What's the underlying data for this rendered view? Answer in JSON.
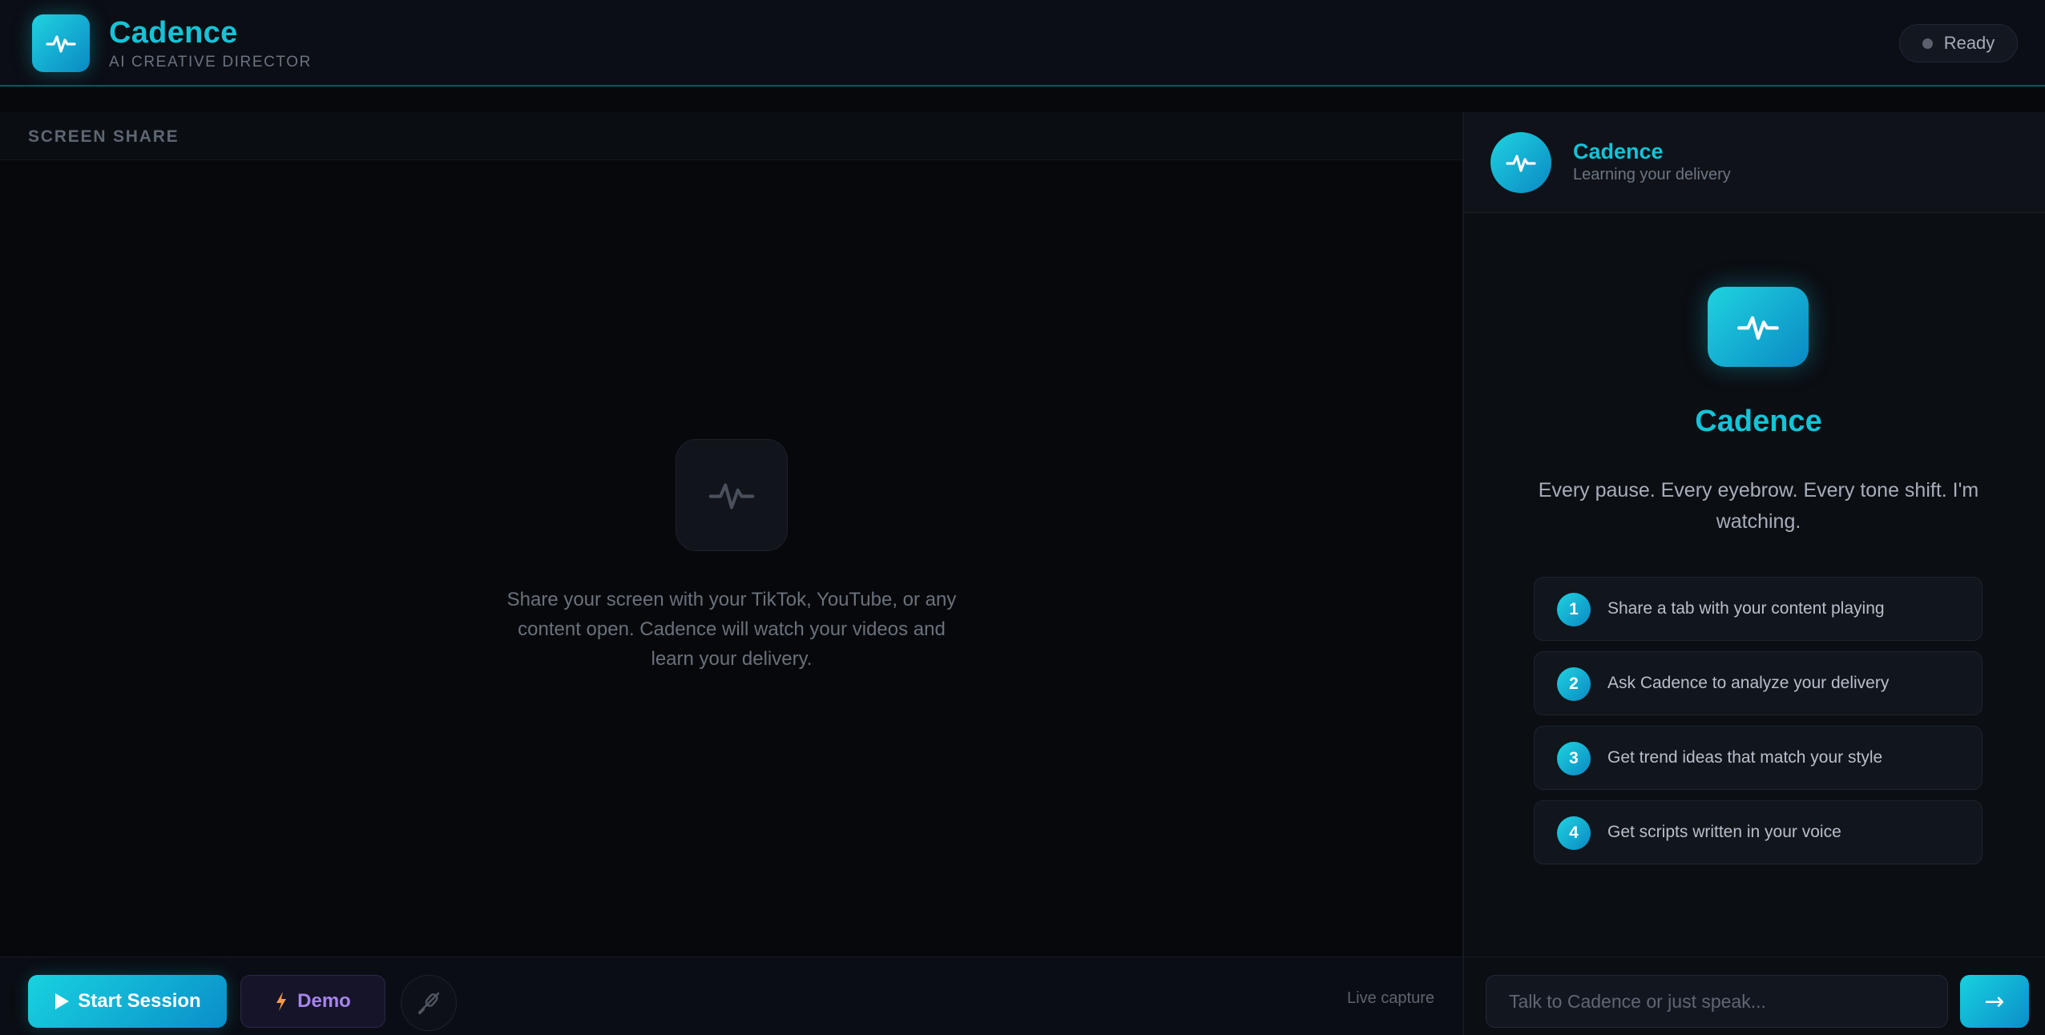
{
  "header": {
    "brand_name": "Cadence",
    "brand_subtitle": "AI CREATIVE DIRECTOR",
    "status": "Ready"
  },
  "screen_share": {
    "title": "SCREEN SHARE",
    "placeholder_text": "Share your screen with your TikTok, YouTube, or any content open. Cadence will watch your videos and learn your delivery.",
    "start_label": "Start Session",
    "demo_label": "Demo",
    "live_capture_label": "Live capture"
  },
  "chat": {
    "name": "Cadence",
    "status": "Learning your delivery",
    "hero_name": "Cadence",
    "tagline": "Every pause. Every eyebrow. Every tone shift. I'm watching.",
    "steps": [
      {
        "num": "1",
        "label": "Share a tab with your content playing"
      },
      {
        "num": "2",
        "label": "Ask Cadence to analyze your delivery"
      },
      {
        "num": "3",
        "label": "Get trend ideas that match your style"
      },
      {
        "num": "4",
        "label": "Get scripts written in your voice"
      }
    ],
    "input_placeholder": "Talk to Cadence or just speak...",
    "send_label": "→"
  },
  "colors": {
    "accent": "#14c3d6",
    "accent_gradient_start": "#1fd3df",
    "accent_gradient_end": "#0a89c4",
    "demo_purple": "#a585ea",
    "demo_bolt": "#f39a4a",
    "background": "#07090d"
  },
  "icons": {
    "logo": "pulse-icon",
    "start": "play-icon",
    "demo": "bolt-icon",
    "mic": "mic-slash-icon"
  }
}
